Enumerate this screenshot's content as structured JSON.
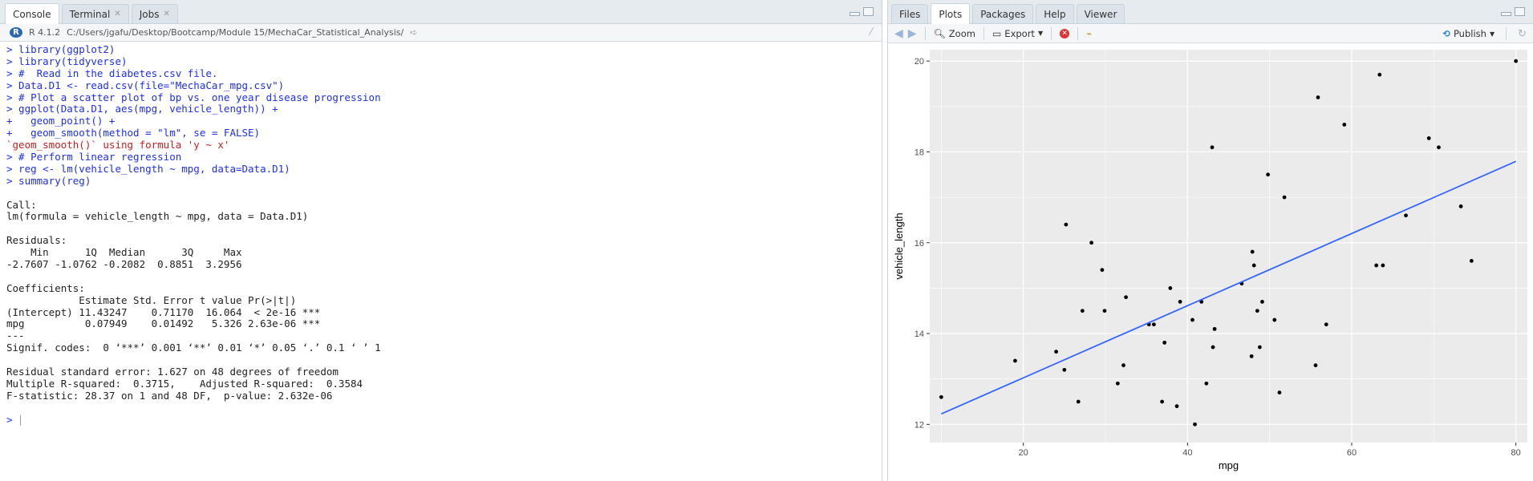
{
  "console": {
    "tabs": [
      {
        "label": "Console",
        "active": true,
        "closable": false
      },
      {
        "label": "Terminal",
        "active": false,
        "closable": true
      },
      {
        "label": "Jobs",
        "active": false,
        "closable": true
      }
    ],
    "r_version": "R 4.1.2",
    "path": "C:/Users/jgafu/Desktop/Bootcamp/Module 15/MechaCar_Statistical_Analysis/",
    "lines": [
      {
        "type": "cmd",
        "text": "> library(ggplot2)"
      },
      {
        "type": "cmd",
        "text": "> library(tidyverse)"
      },
      {
        "type": "cmd",
        "text": "> #  Read in the diabetes.csv file."
      },
      {
        "type": "cmd",
        "text": "> Data.D1 <- read.csv(file=\"MechaCar_mpg.csv\")"
      },
      {
        "type": "cmd",
        "text": "> # Plot a scatter plot of bp vs. one year disease progression"
      },
      {
        "type": "cmd",
        "text": "> ggplot(Data.D1, aes(mpg, vehicle_length)) +"
      },
      {
        "type": "cmd",
        "text": "+   geom_point() +"
      },
      {
        "type": "cmd",
        "text": "+   geom_smooth(method = \"lm\", se = FALSE)"
      },
      {
        "type": "msg",
        "text": "`geom_smooth()` using formula 'y ~ x'"
      },
      {
        "type": "cmd",
        "text": "> # Perform linear regression"
      },
      {
        "type": "cmd",
        "text": "> reg <- lm(vehicle_length ~ mpg, data=Data.D1)"
      },
      {
        "type": "cmd",
        "text": "> summary(reg)"
      },
      {
        "type": "out",
        "text": ""
      },
      {
        "type": "out",
        "text": "Call:"
      },
      {
        "type": "out",
        "text": "lm(formula = vehicle_length ~ mpg, data = Data.D1)"
      },
      {
        "type": "out",
        "text": ""
      },
      {
        "type": "out",
        "text": "Residuals:"
      },
      {
        "type": "out",
        "text": "    Min      1Q  Median      3Q     Max "
      },
      {
        "type": "out",
        "text": "-2.7607 -1.0762 -0.2082  0.8851  3.2956 "
      },
      {
        "type": "out",
        "text": ""
      },
      {
        "type": "out",
        "text": "Coefficients:"
      },
      {
        "type": "out",
        "text": "            Estimate Std. Error t value Pr(>|t|)    "
      },
      {
        "type": "out",
        "text": "(Intercept) 11.43247    0.71170  16.064  < 2e-16 ***"
      },
      {
        "type": "out",
        "text": "mpg          0.07949    0.01492   5.326 2.63e-06 ***"
      },
      {
        "type": "out",
        "text": "---"
      },
      {
        "type": "out",
        "text": "Signif. codes:  0 ‘***’ 0.001 ‘**’ 0.01 ‘*’ 0.05 ‘.’ 0.1 ‘ ’ 1"
      },
      {
        "type": "out",
        "text": ""
      },
      {
        "type": "out",
        "text": "Residual standard error: 1.627 on 48 degrees of freedom"
      },
      {
        "type": "out",
        "text": "Multiple R-squared:  0.3715,\tAdjusted R-squared:  0.3584 "
      },
      {
        "type": "out",
        "text": "F-statistic: 28.37 on 1 and 48 DF,  p-value: 2.632e-06"
      },
      {
        "type": "out",
        "text": ""
      }
    ],
    "prompt": ">"
  },
  "plots_pane": {
    "tabs": [
      {
        "label": "Files",
        "active": false
      },
      {
        "label": "Plots",
        "active": true
      },
      {
        "label": "Packages",
        "active": false
      },
      {
        "label": "Help",
        "active": false
      },
      {
        "label": "Viewer",
        "active": false
      }
    ],
    "toolbar": {
      "zoom": "Zoom",
      "export": "Export",
      "publish": "Publish"
    }
  },
  "colors": {
    "regression_line": "#3366FF",
    "panel_bg": "#EBEBEB",
    "grid": "#FFFFFF",
    "points": "#000000"
  },
  "chart_data": {
    "type": "scatter",
    "title": "",
    "xlabel": "mpg",
    "ylabel": "vehicle_length",
    "xlim": [
      8.6,
      81.4
    ],
    "ylim": [
      11.6,
      20.25
    ],
    "xticks": [
      20,
      40,
      60,
      80
    ],
    "yticks": [
      12,
      14,
      16,
      18,
      20
    ],
    "grid": true,
    "legend": "none",
    "series": [
      {
        "points": [
          [
            10.0,
            12.6
          ],
          [
            19.0,
            13.4
          ],
          [
            24.0,
            13.6
          ],
          [
            25.0,
            13.2
          ],
          [
            25.2,
            16.4
          ],
          [
            26.7,
            12.5
          ],
          [
            27.2,
            14.5
          ],
          [
            28.3,
            16.0
          ],
          [
            29.6,
            15.4
          ],
          [
            29.9,
            14.5
          ],
          [
            31.5,
            12.9
          ],
          [
            32.2,
            13.3
          ],
          [
            32.5,
            14.8
          ],
          [
            35.3,
            14.2
          ],
          [
            35.9,
            14.2
          ],
          [
            36.9,
            12.5
          ],
          [
            37.2,
            13.8
          ],
          [
            37.9,
            15.0
          ],
          [
            38.7,
            12.4
          ],
          [
            39.1,
            14.7
          ],
          [
            40.6,
            14.3
          ],
          [
            40.9,
            12.0
          ],
          [
            41.7,
            14.7
          ],
          [
            42.3,
            12.9
          ],
          [
            43.0,
            18.1
          ],
          [
            43.1,
            13.7
          ],
          [
            43.3,
            14.1
          ],
          [
            46.6,
            15.1
          ],
          [
            47.8,
            13.5
          ],
          [
            47.9,
            15.8
          ],
          [
            48.1,
            15.5
          ],
          [
            48.5,
            14.5
          ],
          [
            48.8,
            13.7
          ],
          [
            49.1,
            14.7
          ],
          [
            49.8,
            17.5
          ],
          [
            50.6,
            14.3
          ],
          [
            51.2,
            12.7
          ],
          [
            51.8,
            17.0
          ],
          [
            55.6,
            13.3
          ],
          [
            55.9,
            19.2
          ],
          [
            56.9,
            14.2
          ],
          [
            59.1,
            18.6
          ],
          [
            63.0,
            15.5
          ],
          [
            63.4,
            19.7
          ],
          [
            63.8,
            15.5
          ],
          [
            66.6,
            16.6
          ],
          [
            69.4,
            18.3
          ],
          [
            70.6,
            18.1
          ],
          [
            73.3,
            16.8
          ],
          [
            74.6,
            15.6
          ],
          [
            80.0,
            20.0
          ]
        ]
      }
    ],
    "fit_line": {
      "x": [
        10,
        80
      ],
      "y": [
        12.23,
        17.79
      ]
    }
  }
}
